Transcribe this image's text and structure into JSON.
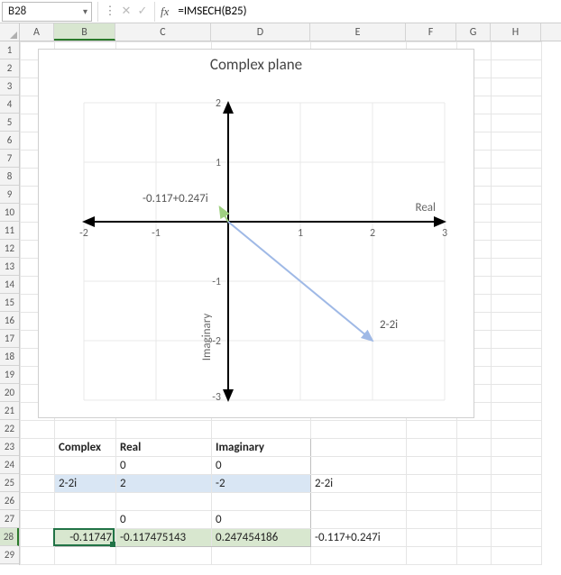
{
  "formula_bar": {
    "cell_ref": "B28",
    "formula": "=IMSECH(B25)",
    "fx_label": "fx"
  },
  "columns": [
    "A",
    "B",
    "C",
    "D",
    "E",
    "F",
    "G",
    "H"
  ],
  "selected_col": "B",
  "row_count": 29,
  "selected_row": 28,
  "table": {
    "headers": {
      "complex": "Complex",
      "real": "Real",
      "imag": "Imaginary"
    },
    "r24": {
      "real": "0",
      "imag": "0"
    },
    "r25": {
      "complex": "2-2i",
      "real": "2",
      "imag": "-2",
      "label": "2-2i"
    },
    "r27": {
      "real": "0",
      "imag": "0"
    },
    "r28": {
      "b": "-0.11747",
      "real": "-0.117475143",
      "imag": "0.247454186",
      "label": "-0.117+0.247i"
    }
  },
  "chart": {
    "title": "Complex plane",
    "x_label": "Real",
    "y_label": "Imaginary",
    "point1_label": "-0.117+0.247i",
    "point2_label": "2-2i",
    "ticks_x": {
      "n2": "-2",
      "n1": "-1",
      "p1": "1",
      "p2": "2",
      "p3": "3"
    },
    "ticks_y": {
      "n3": "-3",
      "n2": "-2",
      "n1": "-1",
      "p1": "1",
      "p2": "2"
    }
  },
  "chart_data": {
    "type": "scatter",
    "title": "Complex plane",
    "xlabel": "Real",
    "ylabel": "Imaginary",
    "xlim": [
      -2,
      3
    ],
    "ylim": [
      -3,
      2
    ],
    "series": [
      {
        "name": "2-2i",
        "x": [
          0,
          2
        ],
        "y": [
          0,
          -2
        ],
        "color": "#9fb9e6"
      },
      {
        "name": "-0.117+0.247i",
        "x": [
          0,
          -0.117
        ],
        "y": [
          0,
          0.247
        ],
        "color": "#9fd080"
      }
    ]
  }
}
